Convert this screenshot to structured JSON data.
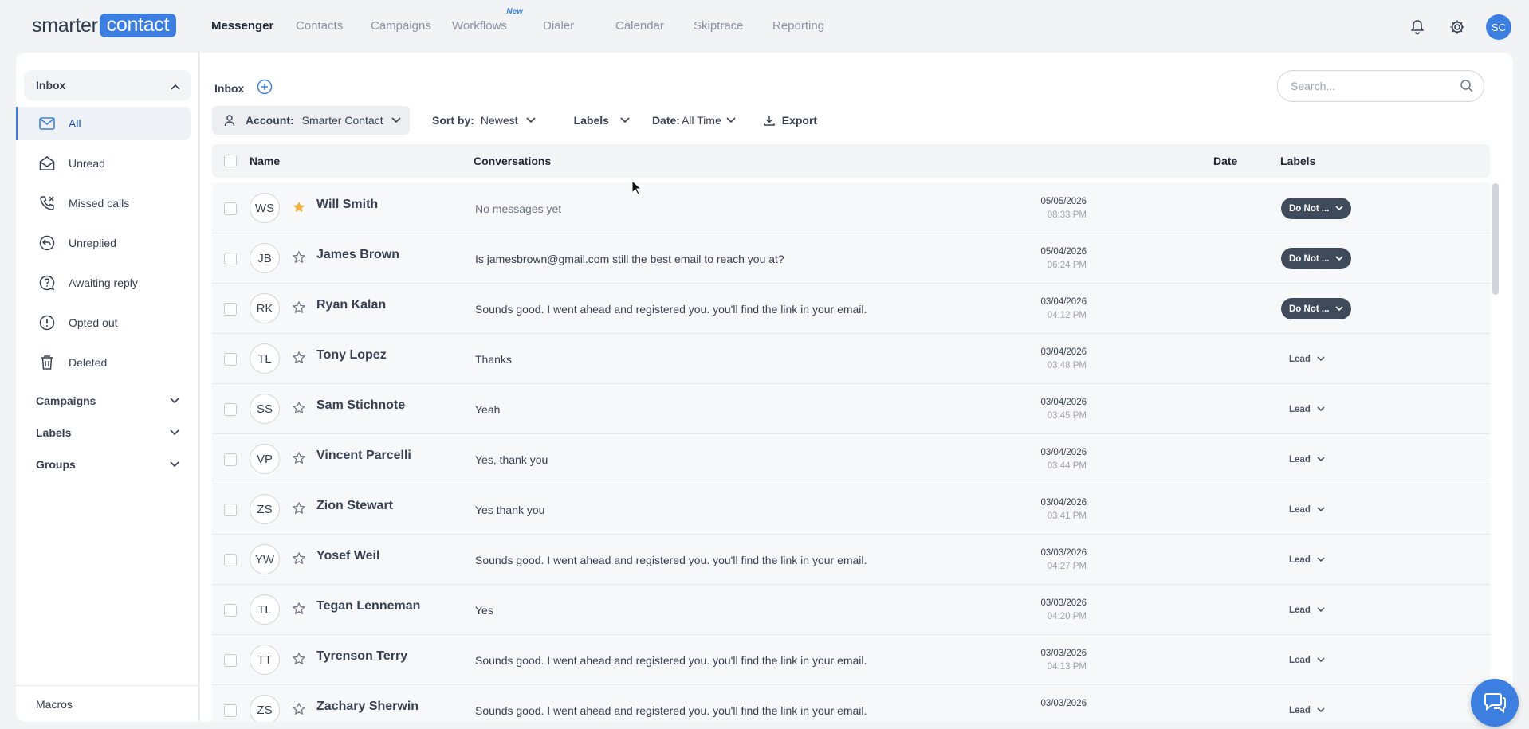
{
  "logo": {
    "part1": "smarter",
    "part2": "contact"
  },
  "nav": [
    {
      "label": "Messenger",
      "active": true
    },
    {
      "label": "Contacts"
    },
    {
      "label": "Campaigns"
    },
    {
      "label": "Workflows",
      "badge": "New"
    },
    {
      "label": "Dialer"
    },
    {
      "label": "Calendar"
    },
    {
      "label": "Skiptrace"
    },
    {
      "label": "Reporting"
    }
  ],
  "user_initials": "SC",
  "sidebar": {
    "inbox_label": "Inbox",
    "items": [
      {
        "label": "All",
        "icon": "mail-icon",
        "active": true
      },
      {
        "label": "Unread",
        "icon": "envelope-open-icon"
      },
      {
        "label": "Missed calls",
        "icon": "missed-call-icon"
      },
      {
        "label": "Unreplied",
        "icon": "reply-icon"
      },
      {
        "label": "Awaiting reply",
        "icon": "question-icon"
      },
      {
        "label": "Opted out",
        "icon": "alert-icon"
      },
      {
        "label": "Deleted",
        "icon": "trash-icon"
      }
    ],
    "sections": [
      "Campaigns",
      "Labels",
      "Groups"
    ],
    "macros": "Macros"
  },
  "main": {
    "title": "Inbox",
    "search_placeholder": "Search...",
    "filters": {
      "account_label": "Account:",
      "account_value": "Smarter Contact",
      "sort_label": "Sort by:",
      "sort_value": "Newest",
      "labels": "Labels",
      "date_label": "Date:",
      "date_value": "All Time",
      "export": "Export"
    },
    "columns": {
      "name": "Name",
      "conversations": "Conversations",
      "date": "Date",
      "labels": "Labels"
    }
  },
  "rows": [
    {
      "initials": "WS",
      "name": "Will Smith",
      "starred": true,
      "message": "No messages yet",
      "muted": true,
      "date": "05/05/2026",
      "time": "08:33 PM",
      "label": "Do Not ...",
      "label_style": "dark"
    },
    {
      "initials": "JB",
      "name": "James Brown",
      "starred": false,
      "message": "Is jamesbrown@gmail.com still the best email to reach you at?",
      "date": "05/04/2026",
      "time": "06:24 PM",
      "label": "Do Not ...",
      "label_style": "dark"
    },
    {
      "initials": "RK",
      "name": "Ryan Kalan",
      "starred": false,
      "message": "Sounds good. I went ahead and registered you. you'll find the link in your email.",
      "date": "03/04/2026",
      "time": "04:12 PM",
      "label": "Do Not ...",
      "label_style": "dark"
    },
    {
      "initials": "TL",
      "name": "Tony Lopez",
      "starred": false,
      "message": "Thanks",
      "date": "03/04/2026",
      "time": "03:48 PM",
      "label": "Lead",
      "label_style": "light"
    },
    {
      "initials": "SS",
      "name": "Sam Stichnote",
      "starred": false,
      "message": "Yeah",
      "date": "03/04/2026",
      "time": "03:45 PM",
      "label": "Lead",
      "label_style": "light"
    },
    {
      "initials": "VP",
      "name": "Vincent Parcelli",
      "starred": false,
      "message": "Yes, thank you",
      "date": "03/04/2026",
      "time": "03:44 PM",
      "label": "Lead",
      "label_style": "light"
    },
    {
      "initials": "ZS",
      "name": "Zion Stewart",
      "starred": false,
      "message": "Yes thank you",
      "date": "03/04/2026",
      "time": "03:41 PM",
      "label": "Lead",
      "label_style": "light"
    },
    {
      "initials": "YW",
      "name": "Yosef Weil",
      "starred": false,
      "message": "Sounds good. I went ahead and registered you. you'll find the link in your email.",
      "date": "03/03/2026",
      "time": "04:27 PM",
      "label": "Lead",
      "label_style": "light"
    },
    {
      "initials": "TL",
      "name": "Tegan Lenneman",
      "starred": false,
      "message": "Yes",
      "date": "03/03/2026",
      "time": "04:20 PM",
      "label": "Lead",
      "label_style": "light"
    },
    {
      "initials": "TT",
      "name": "Tyrenson Terry",
      "starred": false,
      "message": "Sounds good. I went ahead and registered you. you'll find the link in your email.",
      "date": "03/03/2026",
      "time": "04:13 PM",
      "label": "Lead",
      "label_style": "light"
    },
    {
      "initials": "ZS",
      "name": "Zachary Sherwin",
      "starred": false,
      "message": "Sounds good. I went ahead and registered you. you'll find the link in your email.",
      "date": "03/03/2026",
      "time": "",
      "label": "Lead",
      "label_style": "light"
    }
  ],
  "colors": {
    "accent": "#3c7fe0",
    "label_dark": "#3f4a5a",
    "star": "#f0b13b"
  }
}
